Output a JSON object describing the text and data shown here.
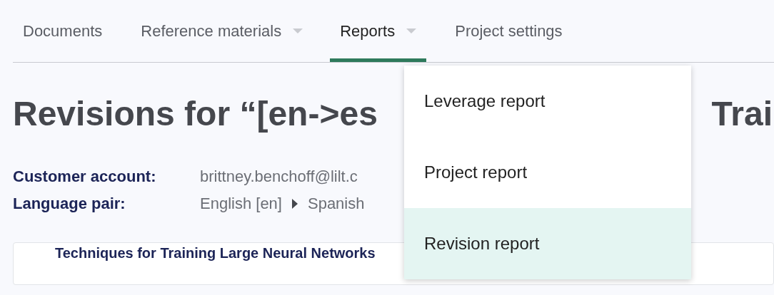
{
  "tabs": [
    {
      "label": "Documents",
      "has_menu": false,
      "selected": false
    },
    {
      "label": "Reference materials",
      "has_menu": true,
      "selected": false
    },
    {
      "label": "Reports",
      "has_menu": true,
      "selected": true
    },
    {
      "label": "Project settings",
      "has_menu": false,
      "selected": false
    }
  ],
  "title": {
    "visible_start": "Revisions for “[en->es",
    "visible_end": "Trai"
  },
  "details": [
    {
      "label": "Customer account:",
      "value": "brittney.benchoff@lilt.c"
    },
    {
      "label": "Language pair:",
      "source": "English [en]",
      "target": "Spanish"
    }
  ],
  "document_card": {
    "name": "Techniques for Training Large Neural Networks"
  },
  "reports_menu": [
    {
      "label": "Leverage report",
      "selected": false
    },
    {
      "label": "Project report",
      "selected": false
    },
    {
      "label": "Revision report",
      "selected": true
    }
  ]
}
